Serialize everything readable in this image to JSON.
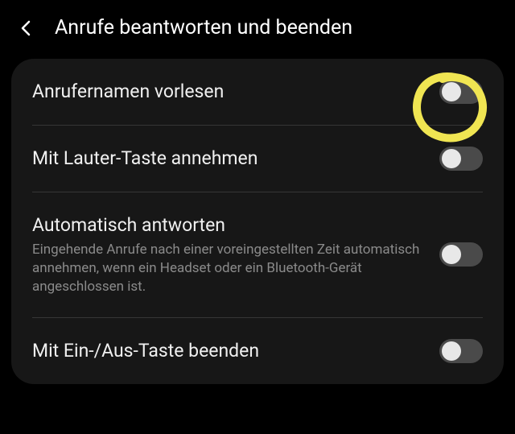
{
  "header": {
    "title": "Anrufe beantworten und beenden"
  },
  "settings": [
    {
      "title": "Anrufernamen vorlesen",
      "subtitle": null,
      "enabled": false,
      "highlighted": true
    },
    {
      "title": "Mit Lauter-Taste annehmen",
      "subtitle": null,
      "enabled": false,
      "highlighted": false
    },
    {
      "title": "Automatisch antworten",
      "subtitle": "Eingehende Anrufe nach einer voreingestellten Zeit automatisch annehmen, wenn ein Headset oder ein Bluetooth-Gerät angeschlossen ist.",
      "enabled": false,
      "highlighted": false
    },
    {
      "title": "Mit Ein-/Aus-Taste beenden",
      "subtitle": null,
      "enabled": false,
      "highlighted": false
    }
  ],
  "annotation": {
    "color": "#f0e552"
  }
}
